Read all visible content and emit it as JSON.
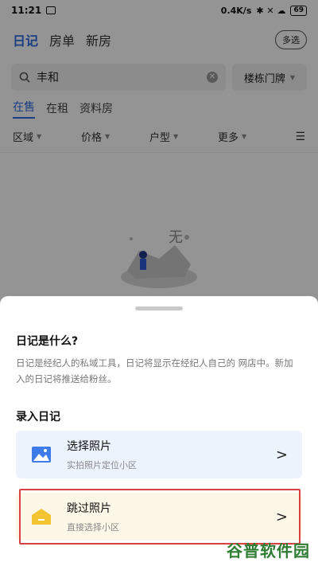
{
  "status_bar": {
    "time": "11:21",
    "net_speed": "0.4K/s",
    "signal_icons": "✱ ✕ ☁",
    "battery": "69"
  },
  "top_tabs": [
    {
      "label": "日记",
      "active": true
    },
    {
      "label": "房单",
      "active": false
    },
    {
      "label": "新房",
      "active": false
    }
  ],
  "multi_select_label": "多选",
  "search": {
    "value": "丰和",
    "building_select": "楼栋门牌"
  },
  "sub_tabs": [
    {
      "label": "在售",
      "active": true
    },
    {
      "label": "在租",
      "active": false
    },
    {
      "label": "资料房",
      "active": false
    }
  ],
  "filters": [
    "区域",
    "价格",
    "户型",
    "更多"
  ],
  "empty_glyph": "无",
  "sheet": {
    "title": "日记是什么?",
    "description": "日记是经纪人的私域工具，日记将显示在经纪人自己的 网店中。新加入的日记将推送给粉丝。",
    "section_label": "录入日记",
    "options": [
      {
        "title": "选择照片",
        "subtitle": "实拍照片定位小区"
      },
      {
        "title": "跳过照片",
        "subtitle": "直接选择小区"
      }
    ]
  },
  "watermark": "谷普软件园",
  "colors": {
    "accent": "#2d6be4",
    "highlight_border": "#d94040",
    "option1_bg": "#ecf3fc",
    "option2_bg": "#fdf7e7"
  }
}
